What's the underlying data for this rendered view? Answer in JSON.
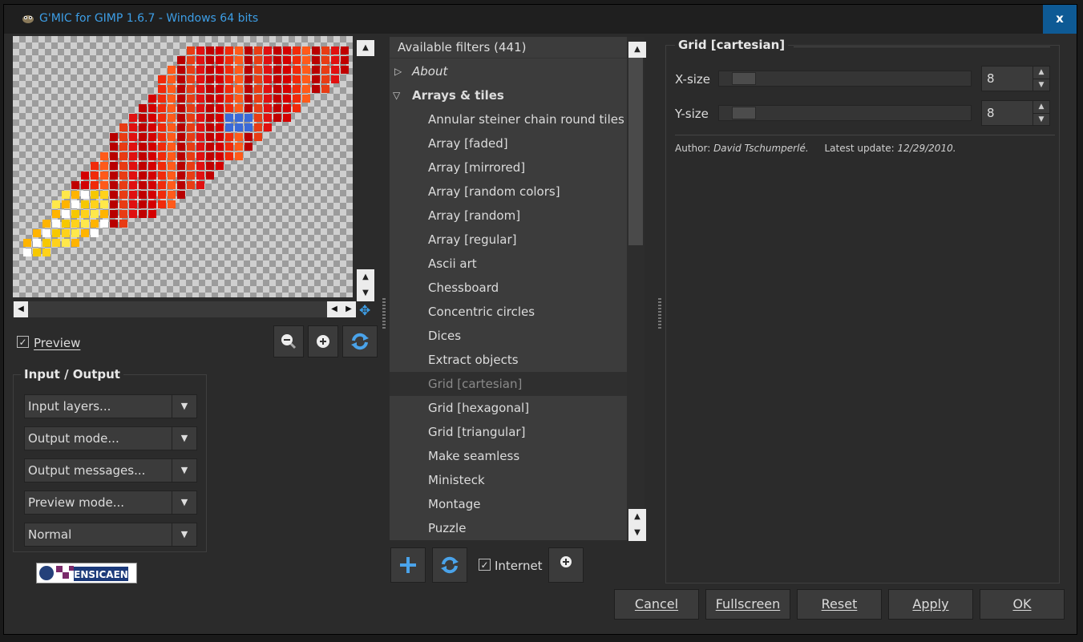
{
  "window": {
    "title": "G'MIC for GIMP 1.6.7 - Windows 64 bits",
    "close_label": "x"
  },
  "preview": {
    "checkbox_label": "Preview",
    "checked": true,
    "zoom_out_icon": "zoom-out-icon",
    "zoom_in_icon": "zoom-in-icon",
    "refresh_icon": "refresh-icon"
  },
  "io": {
    "title": "Input / Output",
    "combos": [
      "Input layers...",
      "Output mode...",
      "Output messages...",
      "Preview mode...",
      "Normal"
    ]
  },
  "logo": {
    "text": "ENSICAEN"
  },
  "filters": {
    "header": "Available filters (441)",
    "categories": [
      {
        "label": "About",
        "expanded": false
      },
      {
        "label": "Arrays & tiles",
        "expanded": true
      }
    ],
    "items": [
      "Annular steiner chain round tiles",
      "Array [faded]",
      "Array [mirrored]",
      "Array [random colors]",
      "Array [random]",
      "Array [regular]",
      "Ascii art",
      "Chessboard",
      "Concentric circles",
      "Dices",
      "Extract objects",
      "Grid [cartesian]",
      "Grid [hexagonal]",
      "Grid [triangular]",
      "Make seamless",
      "Ministeck",
      "Montage",
      "Puzzle"
    ],
    "selected": "Grid [cartesian]",
    "internet_label": "Internet",
    "internet_checked": true
  },
  "params": {
    "title": "Grid [cartesian]",
    "x_label": "X-size",
    "x_value": "8",
    "y_label": "Y-size",
    "y_value": "8",
    "author_label": "Author:",
    "author": "David Tschumperlé.",
    "update_label": "Latest update:",
    "update": "12/29/2010."
  },
  "buttons": {
    "cancel": "Cancel",
    "fullscreen": "Fullscreen",
    "reset": "Reset",
    "apply": "Apply",
    "ok": "OK"
  },
  "colors": {
    "accent": "#3d9ee6",
    "bg": "#2b2b2b",
    "panel": "#3c3c3c"
  }
}
